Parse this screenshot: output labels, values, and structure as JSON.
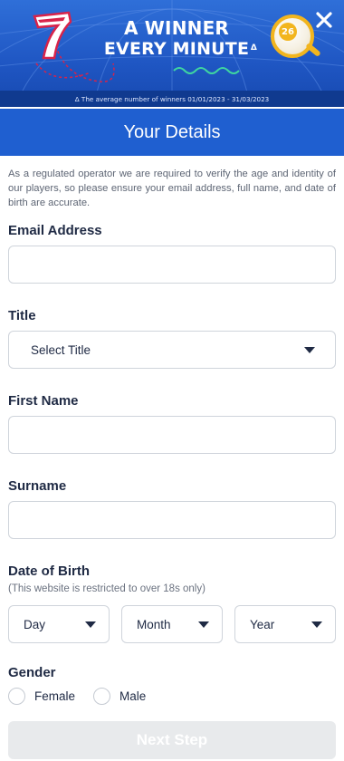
{
  "banner": {
    "headline_line1": "A WINNER",
    "headline_line2": "EVERY MINUTE",
    "headline_mark": "Δ",
    "ball_number": "26",
    "disclaimer": "Δ The average number of winners 01/01/2023 - 31/03/2023",
    "colors": {
      "background": "#1f56c3",
      "ball_ring": "#f2b51e",
      "seven": "#d8234a"
    }
  },
  "page": {
    "title": "Your Details",
    "intro": "As a regulated operator we are required to verify the age and identity of our players, so please ensure your email address, full name, and date of birth are accurate."
  },
  "form": {
    "email": {
      "label": "Email Address",
      "value": ""
    },
    "title": {
      "label": "Title",
      "selected": "Select Title"
    },
    "first_name": {
      "label": "First Name",
      "value": ""
    },
    "surname": {
      "label": "Surname",
      "value": ""
    },
    "dob": {
      "label": "Date of Birth",
      "hint": "(This website is restricted to over 18s only)",
      "day": "Day",
      "month": "Month",
      "year": "Year"
    },
    "gender": {
      "label": "Gender",
      "options": [
        "Female",
        "Male"
      ]
    },
    "next_label": "Next Step"
  },
  "icons": {
    "close": "close-icon",
    "dropdown": "chevron-down-icon"
  }
}
